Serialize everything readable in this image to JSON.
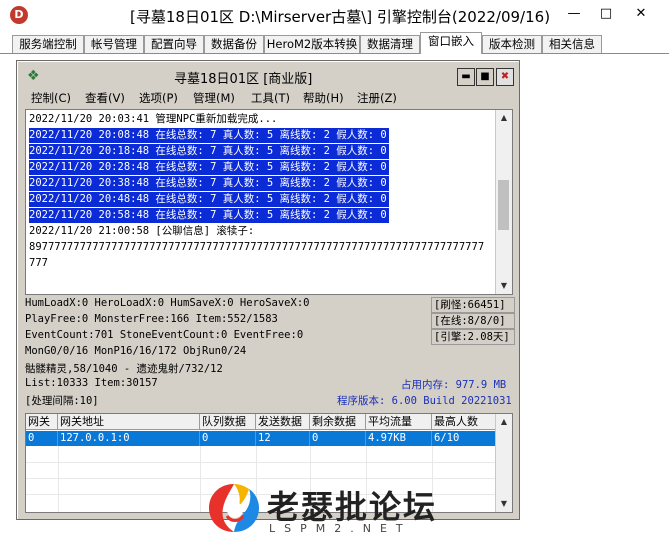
{
  "outer": {
    "title": "[寻墓18日01区 D:\\Mirserver古墓\\] 引擎控制台(2022/09/16)",
    "icon": "D",
    "minimize": "—",
    "maximize": "□",
    "close": "✕"
  },
  "tabs": [
    {
      "label": "服务端控制"
    },
    {
      "label": "帐号管理"
    },
    {
      "label": "配置向导"
    },
    {
      "label": "数据备份"
    },
    {
      "label": "HeroM2版本转换"
    },
    {
      "label": "数据清理"
    },
    {
      "label": "窗口嵌入"
    },
    {
      "label": "版本检测"
    },
    {
      "label": "相关信息"
    }
  ],
  "active_tab": "窗口嵌入",
  "inner": {
    "title": "寻墓18日01区 [商业版]",
    "btn_min": "▬",
    "btn_max": "■",
    "btn_close": "✖"
  },
  "menu": [
    {
      "label": "控制(C)"
    },
    {
      "label": "查看(V)"
    },
    {
      "label": "选项(P)"
    },
    {
      "label": "管理(M)"
    },
    {
      "label": "工具(T)"
    },
    {
      "label": "帮助(H)"
    },
    {
      "label": "注册(Z)"
    }
  ],
  "log": [
    {
      "text": "2022/11/20 20:03:41 管理NPC重新加载完成...",
      "selected": false
    },
    {
      "text": "2022/11/20 20:08:48 在线总数: 7 真人数: 5 离线数: 2 假人数: 0",
      "selected": true
    },
    {
      "text": "2022/11/20 20:18:48 在线总数: 7 真人数: 5 离线数: 2 假人数: 0",
      "selected": true
    },
    {
      "text": "2022/11/20 20:28:48 在线总数: 7 真人数: 5 离线数: 2 假人数: 0",
      "selected": true
    },
    {
      "text": "2022/11/20 20:38:48 在线总数: 7 真人数: 5 离线数: 2 假人数: 0",
      "selected": true
    },
    {
      "text": "2022/11/20 20:48:48 在线总数: 7 真人数: 5 离线数: 2 假人数: 0",
      "selected": true
    },
    {
      "text": "2022/11/20 20:58:48 在线总数: 7 真人数: 5 离线数: 2 假人数: 0",
      "selected": true
    },
    {
      "text": "2022/11/20 21:00:58 [公聊信息] 滚犊子:",
      "selected": false
    },
    {
      "text": "897777777777777777777777777777777777777777777777777777777777777777777777",
      "selected": false
    },
    {
      "text": "777",
      "selected": false
    }
  ],
  "stats": {
    "line1": "HumLoadX:0 HeroLoadX:0 HumSaveX:0 HeroSaveX:0",
    "line2": "PlayFree:0 MonsterFree:166 Item:552/1583",
    "line3": "EventCount:701 StoneEventCount:0 EventFree:0",
    "line4": "MonG0/0/16 MonP16/16/172 ObjRun0/24",
    "line5": "骷髅精灵,58/1040 - 遗迹鬼射/732/12",
    "line6": "List:10333 Item:30157",
    "line7": "[处理间隔:10]",
    "box1": "[刷怪:66451]",
    "box2": "[在线:8/8/0]",
    "box3": "[引擎:2.08天]",
    "memory": "占用内存: 977.9 MB",
    "version": "程序版本: 6.00 Build 20221031"
  },
  "grid": {
    "headers": [
      "网关",
      "网关地址",
      "队列数据",
      "发送数据",
      "剩余数据",
      "平均流量",
      "最高人数"
    ],
    "rows": [
      [
        "0",
        "127.0.0.1:0",
        "0",
        "12",
        "0",
        "4.97KB",
        "6/10"
      ]
    ]
  },
  "watermark": {
    "text": "老瑟批论坛",
    "sub": "LSPM2.NET"
  }
}
